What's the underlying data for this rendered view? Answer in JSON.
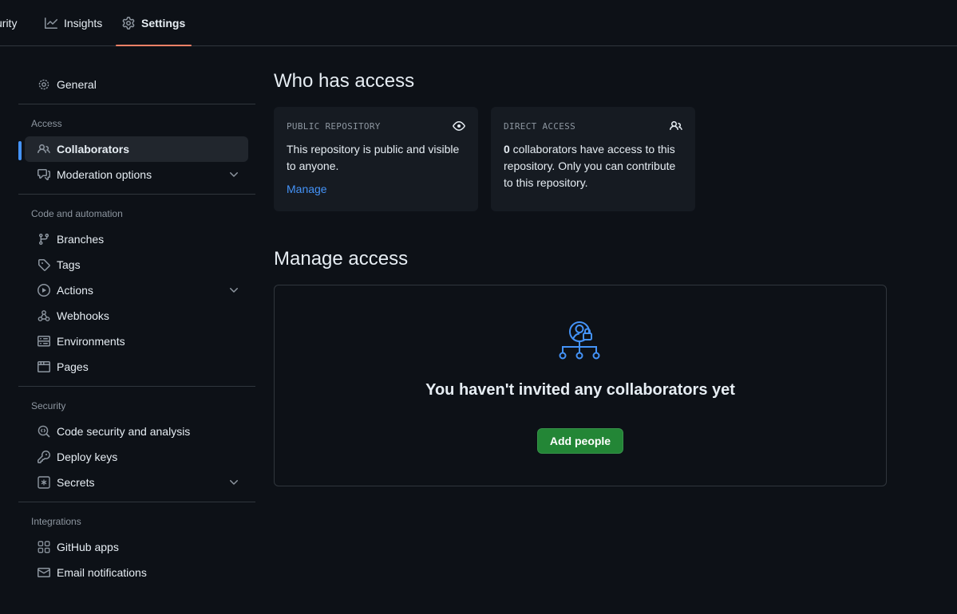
{
  "topnav": {
    "tabs": [
      {
        "label": "curity",
        "icon": "shield-icon"
      },
      {
        "label": "Insights",
        "icon": "graph-icon"
      },
      {
        "label": "Settings",
        "icon": "gear-icon",
        "selected": true
      }
    ]
  },
  "sidebar": {
    "general": "General",
    "groups": [
      {
        "heading": "Access",
        "items": [
          "Collaborators",
          "Moderation options"
        ]
      },
      {
        "heading": "Code and automation",
        "items": [
          "Branches",
          "Tags",
          "Actions",
          "Webhooks",
          "Environments",
          "Pages"
        ]
      },
      {
        "heading": "Security",
        "items": [
          "Code security and analysis",
          "Deploy keys",
          "Secrets"
        ]
      },
      {
        "heading": "Integrations",
        "items": [
          "GitHub apps",
          "Email notifications"
        ]
      }
    ]
  },
  "who_has_access": {
    "title": "Who has access",
    "public_card": {
      "label": "PUBLIC REPOSITORY",
      "text": "This repository is public and visible to anyone.",
      "link": "Manage"
    },
    "direct_card": {
      "label": "DIRECT ACCESS",
      "count": "0",
      "text": " collaborators have access to this repository. Only you can contribute to this repository."
    }
  },
  "manage_access": {
    "title": "Manage access",
    "blank_title": "You haven't invited any collaborators yet",
    "add_button": "Add people"
  },
  "colors": {
    "background": "#0d1117",
    "accent_blue": "#4493f8",
    "tab_underline": "#f78166",
    "button_green": "#238636"
  }
}
